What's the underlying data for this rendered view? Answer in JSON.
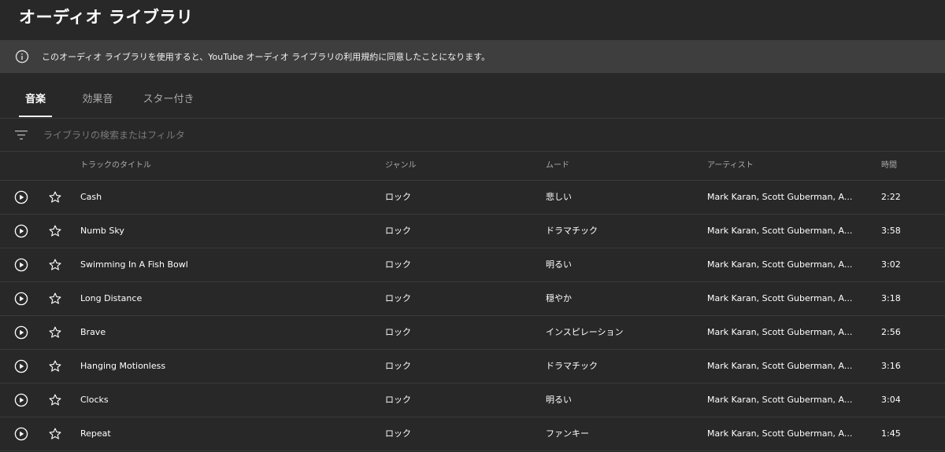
{
  "page": {
    "title": "オーディオ ライブラリ"
  },
  "notice": {
    "icon": "info-icon",
    "text": "このオーディオ ライブラリを使用すると、YouTube オーディオ ライブラリの利用規約に同意したことになります。"
  },
  "tabs": [
    {
      "label": "音楽",
      "active": true
    },
    {
      "label": "効果音",
      "active": false
    },
    {
      "label": "スター付き",
      "active": false
    }
  ],
  "filter": {
    "icon": "filter-icon",
    "placeholder": "ライブラリの検索またはフィルタ",
    "value": ""
  },
  "table": {
    "headers": {
      "title": "トラックのタイトル",
      "genre": "ジャンル",
      "mood": "ムード",
      "artist": "アーティスト",
      "duration": "時間"
    },
    "rows": [
      {
        "title": "Cash",
        "genre": "ロック",
        "mood": "悲しい",
        "artist": "Mark Karan, Scott Guberman, A...",
        "duration": "2:22"
      },
      {
        "title": "Numb Sky",
        "genre": "ロック",
        "mood": "ドラマチック",
        "artist": "Mark Karan, Scott Guberman, A...",
        "duration": "3:58"
      },
      {
        "title": "Swimming In A Fish Bowl",
        "genre": "ロック",
        "mood": "明るい",
        "artist": "Mark Karan, Scott Guberman, A...",
        "duration": "3:02"
      },
      {
        "title": "Long Distance",
        "genre": "ロック",
        "mood": "穏やか",
        "artist": "Mark Karan, Scott Guberman, A...",
        "duration": "3:18"
      },
      {
        "title": "Brave",
        "genre": "ロック",
        "mood": "インスピレーション",
        "artist": "Mark Karan, Scott Guberman, A...",
        "duration": "2:56"
      },
      {
        "title": "Hanging Motionless",
        "genre": "ロック",
        "mood": "ドラマチック",
        "artist": "Mark Karan, Scott Guberman, A...",
        "duration": "3:16"
      },
      {
        "title": "Clocks",
        "genre": "ロック",
        "mood": "明るい",
        "artist": "Mark Karan, Scott Guberman, A...",
        "duration": "3:04"
      },
      {
        "title": "Repeat",
        "genre": "ロック",
        "mood": "ファンキー",
        "artist": "Mark Karan, Scott Guberman, A...",
        "duration": "1:45"
      }
    ]
  },
  "row_icons": {
    "play": "play-circle-icon",
    "star": "star-outline-icon"
  },
  "colors": {
    "background": "#282828",
    "notice_bg": "#3e3e3e",
    "divider": "#3a3a3a",
    "muted_text": "#aaaaaa"
  }
}
